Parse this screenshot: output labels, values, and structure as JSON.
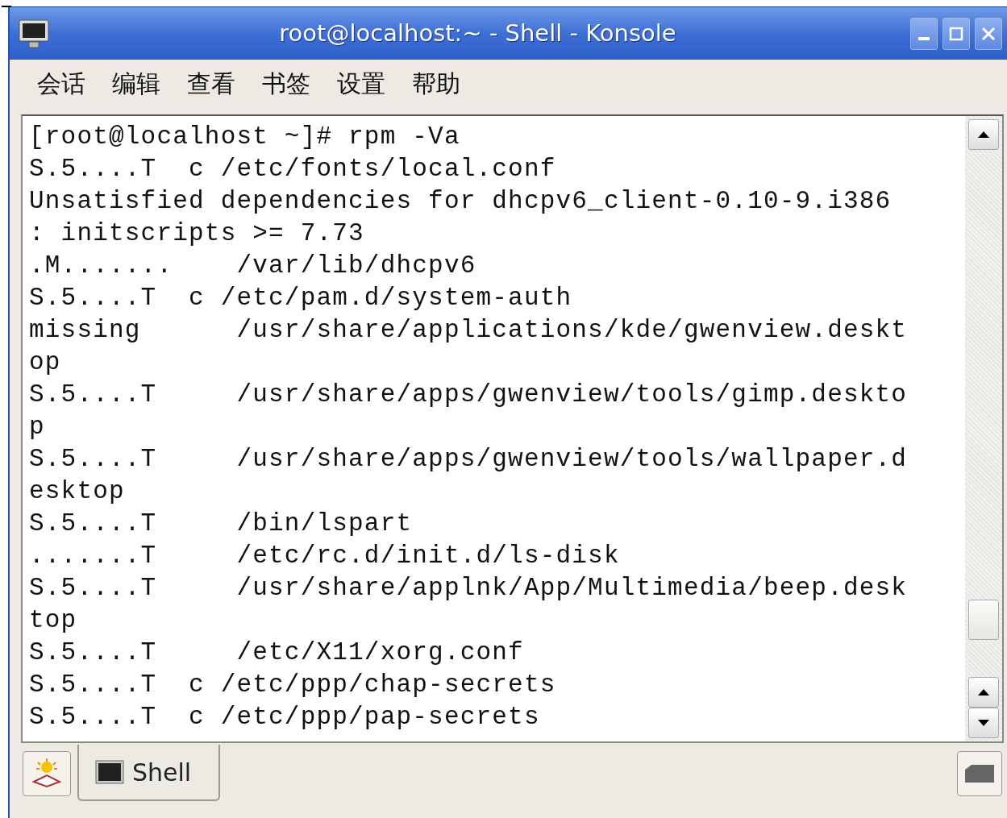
{
  "window": {
    "title": "root@localhost:~ - Shell - Konsole"
  },
  "menu": [
    "会话",
    "编辑",
    "查看",
    "书签",
    "设置",
    "帮助"
  ],
  "terminal": {
    "lines": [
      "[root@localhost ~]# rpm -Va",
      "S.5....T  c /etc/fonts/local.conf",
      "Unsatisfied dependencies for dhcpv6_client-0.10-9.i386",
      ": initscripts >= 7.73",
      ".M.......    /var/lib/dhcpv6",
      "S.5....T  c /etc/pam.d/system-auth",
      "missing      /usr/share/applications/kde/gwenview.deskt",
      "op",
      "S.5....T     /usr/share/apps/gwenview/tools/gimp.deskto",
      "p",
      "S.5....T     /usr/share/apps/gwenview/tools/wallpaper.d",
      "esktop",
      "S.5....T     /bin/lspart",
      ".......T     /etc/rc.d/init.d/ls-disk",
      "S.5....T     /usr/share/applnk/App/Multimedia/beep.desk",
      "top",
      "S.5....T     /etc/X11/xorg.conf",
      "S.5....T  c /etc/ppp/chap-secrets",
      "S.5....T  c /etc/ppp/pap-secrets"
    ]
  },
  "tabs": [
    {
      "label": "Shell",
      "selected": true
    }
  ]
}
